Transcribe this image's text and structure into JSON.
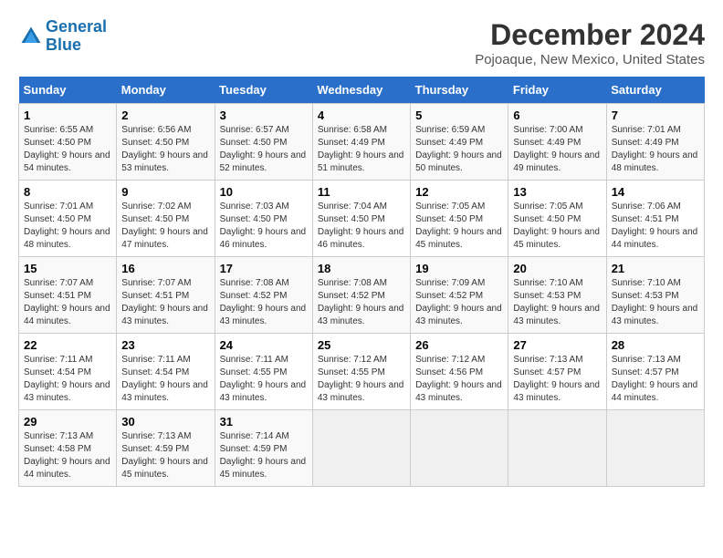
{
  "logo": {
    "line1": "General",
    "line2": "Blue"
  },
  "title": "December 2024",
  "subtitle": "Pojoaque, New Mexico, United States",
  "days_of_week": [
    "Sunday",
    "Monday",
    "Tuesday",
    "Wednesday",
    "Thursday",
    "Friday",
    "Saturday"
  ],
  "weeks": [
    [
      {
        "day": "1",
        "sunrise": "6:55 AM",
        "sunset": "4:50 PM",
        "daylight": "9 hours and 54 minutes."
      },
      {
        "day": "2",
        "sunrise": "6:56 AM",
        "sunset": "4:50 PM",
        "daylight": "9 hours and 53 minutes."
      },
      {
        "day": "3",
        "sunrise": "6:57 AM",
        "sunset": "4:50 PM",
        "daylight": "9 hours and 52 minutes."
      },
      {
        "day": "4",
        "sunrise": "6:58 AM",
        "sunset": "4:49 PM",
        "daylight": "9 hours and 51 minutes."
      },
      {
        "day": "5",
        "sunrise": "6:59 AM",
        "sunset": "4:49 PM",
        "daylight": "9 hours and 50 minutes."
      },
      {
        "day": "6",
        "sunrise": "7:00 AM",
        "sunset": "4:49 PM",
        "daylight": "9 hours and 49 minutes."
      },
      {
        "day": "7",
        "sunrise": "7:01 AM",
        "sunset": "4:49 PM",
        "daylight": "9 hours and 48 minutes."
      }
    ],
    [
      {
        "day": "8",
        "sunrise": "7:01 AM",
        "sunset": "4:50 PM",
        "daylight": "9 hours and 48 minutes."
      },
      {
        "day": "9",
        "sunrise": "7:02 AM",
        "sunset": "4:50 PM",
        "daylight": "9 hours and 47 minutes."
      },
      {
        "day": "10",
        "sunrise": "7:03 AM",
        "sunset": "4:50 PM",
        "daylight": "9 hours and 46 minutes."
      },
      {
        "day": "11",
        "sunrise": "7:04 AM",
        "sunset": "4:50 PM",
        "daylight": "9 hours and 46 minutes."
      },
      {
        "day": "12",
        "sunrise": "7:05 AM",
        "sunset": "4:50 PM",
        "daylight": "9 hours and 45 minutes."
      },
      {
        "day": "13",
        "sunrise": "7:05 AM",
        "sunset": "4:50 PM",
        "daylight": "9 hours and 45 minutes."
      },
      {
        "day": "14",
        "sunrise": "7:06 AM",
        "sunset": "4:51 PM",
        "daylight": "9 hours and 44 minutes."
      }
    ],
    [
      {
        "day": "15",
        "sunrise": "7:07 AM",
        "sunset": "4:51 PM",
        "daylight": "9 hours and 44 minutes."
      },
      {
        "day": "16",
        "sunrise": "7:07 AM",
        "sunset": "4:51 PM",
        "daylight": "9 hours and 43 minutes."
      },
      {
        "day": "17",
        "sunrise": "7:08 AM",
        "sunset": "4:52 PM",
        "daylight": "9 hours and 43 minutes."
      },
      {
        "day": "18",
        "sunrise": "7:08 AM",
        "sunset": "4:52 PM",
        "daylight": "9 hours and 43 minutes."
      },
      {
        "day": "19",
        "sunrise": "7:09 AM",
        "sunset": "4:52 PM",
        "daylight": "9 hours and 43 minutes."
      },
      {
        "day": "20",
        "sunrise": "7:10 AM",
        "sunset": "4:53 PM",
        "daylight": "9 hours and 43 minutes."
      },
      {
        "day": "21",
        "sunrise": "7:10 AM",
        "sunset": "4:53 PM",
        "daylight": "9 hours and 43 minutes."
      }
    ],
    [
      {
        "day": "22",
        "sunrise": "7:11 AM",
        "sunset": "4:54 PM",
        "daylight": "9 hours and 43 minutes."
      },
      {
        "day": "23",
        "sunrise": "7:11 AM",
        "sunset": "4:54 PM",
        "daylight": "9 hours and 43 minutes."
      },
      {
        "day": "24",
        "sunrise": "7:11 AM",
        "sunset": "4:55 PM",
        "daylight": "9 hours and 43 minutes."
      },
      {
        "day": "25",
        "sunrise": "7:12 AM",
        "sunset": "4:55 PM",
        "daylight": "9 hours and 43 minutes."
      },
      {
        "day": "26",
        "sunrise": "7:12 AM",
        "sunset": "4:56 PM",
        "daylight": "9 hours and 43 minutes."
      },
      {
        "day": "27",
        "sunrise": "7:13 AM",
        "sunset": "4:57 PM",
        "daylight": "9 hours and 43 minutes."
      },
      {
        "day": "28",
        "sunrise": "7:13 AM",
        "sunset": "4:57 PM",
        "daylight": "9 hours and 44 minutes."
      }
    ],
    [
      {
        "day": "29",
        "sunrise": "7:13 AM",
        "sunset": "4:58 PM",
        "daylight": "9 hours and 44 minutes."
      },
      {
        "day": "30",
        "sunrise": "7:13 AM",
        "sunset": "4:59 PM",
        "daylight": "9 hours and 45 minutes."
      },
      {
        "day": "31",
        "sunrise": "7:14 AM",
        "sunset": "4:59 PM",
        "daylight": "9 hours and 45 minutes."
      },
      null,
      null,
      null,
      null
    ]
  ],
  "labels": {
    "sunrise": "Sunrise:",
    "sunset": "Sunset:",
    "daylight": "Daylight:"
  }
}
